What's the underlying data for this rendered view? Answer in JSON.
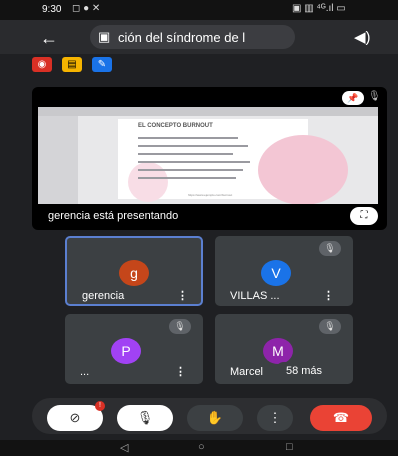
{
  "status_bar": {
    "time": "9:30",
    "left_icons": "◻ ● ✕",
    "right_icons": "▣ ▥ ⁴ᴳ.ıl ▭"
  },
  "top_bar": {
    "back_icon": "←",
    "calendar_icon": "▣",
    "title": "ción del síndrome de l",
    "speaker_icon": "◀)"
  },
  "chips": [
    {
      "label": "◉",
      "color": "#d93025"
    },
    {
      "label": "▤",
      "color": "#f6b400"
    },
    {
      "label": "✎",
      "color": "#1a73e8"
    }
  ],
  "presentation": {
    "slide_title": "EL CONCEPTO BURNOUT",
    "slide_url": "https://www.ejemplo.com/burnout",
    "pin_icon": "📌",
    "mic_off_icon": "🎙",
    "presenter_text": "gerencia está presentando",
    "fullscreen_icon": "⛶"
  },
  "participants": [
    {
      "name": "gerencia",
      "initial": "g",
      "color": "#c5461a",
      "active": true,
      "muted": false
    },
    {
      "name": "VILLAS ...",
      "initial": "V",
      "color": "#1a73e8",
      "active": false,
      "muted": true
    },
    {
      "name": "...",
      "initial": "P",
      "color": "#a142f4",
      "active": false,
      "muted": true
    },
    {
      "name": "Marcel",
      "initial": "M",
      "color": "#8e24aa",
      "active": false,
      "muted": true
    }
  ],
  "more_label": "58 más",
  "controls": {
    "camera_off_icon": "⊘",
    "camera_badge": "!",
    "mic_off_icon": "🎙",
    "raise_hand_icon": "✋",
    "more_icon": "⋮",
    "end_call_icon": "☎"
  },
  "nav": {
    "back": "◁",
    "home": "○",
    "recents": "□"
  }
}
